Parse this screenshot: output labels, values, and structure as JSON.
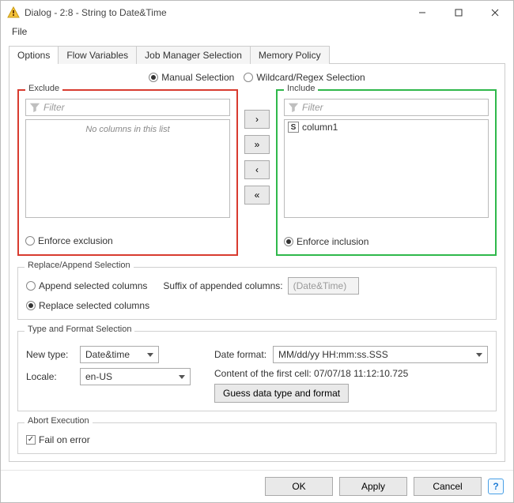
{
  "window": {
    "title": "Dialog - 2:8 - String to Date&Time",
    "minimize_label": "Minimize",
    "maximize_label": "Maximize",
    "close_label": "Close"
  },
  "menubar": {
    "file_label": "File"
  },
  "tabs": {
    "options": "Options",
    "flow_variables": "Flow Variables",
    "job_manager": "Job Manager Selection",
    "memory_policy": "Memory Policy"
  },
  "selection_mode": {
    "manual": "Manual Selection",
    "wildcard": "Wildcard/Regex Selection"
  },
  "exclude": {
    "legend": "Exclude",
    "filter_placeholder": "Filter",
    "empty_text": "No columns in this list",
    "enforce_label": "Enforce exclusion"
  },
  "include": {
    "legend": "Include",
    "filter_placeholder": "Filter",
    "items": [
      {
        "label": "column1",
        "type_badge": "S"
      }
    ],
    "enforce_label": "Enforce inclusion"
  },
  "move_buttons": {
    "include_one": "›",
    "include_all": "»",
    "exclude_one": "‹",
    "exclude_all": "«"
  },
  "replace_append": {
    "legend": "Replace/Append Selection",
    "append_label": "Append selected columns",
    "replace_label": "Replace selected columns",
    "suffix_label": "Suffix of appended columns:",
    "suffix_placeholder": "(Date&Time)"
  },
  "type_format": {
    "legend": "Type and Format Selection",
    "new_type_label": "New type:",
    "new_type_value": "Date&time",
    "date_format_label": "Date format:",
    "date_format_value": "MM/dd/yy HH:mm:ss.SSS",
    "locale_label": "Locale:",
    "locale_value": "en-US",
    "first_cell_label": "Content of the first cell: 07/07/18 11:12:10.725",
    "guess_button": "Guess data type and format"
  },
  "abort": {
    "legend": "Abort Execution",
    "fail_on_error_label": "Fail on error"
  },
  "footer": {
    "ok": "OK",
    "apply": "Apply",
    "cancel": "Cancel",
    "help": "?"
  }
}
